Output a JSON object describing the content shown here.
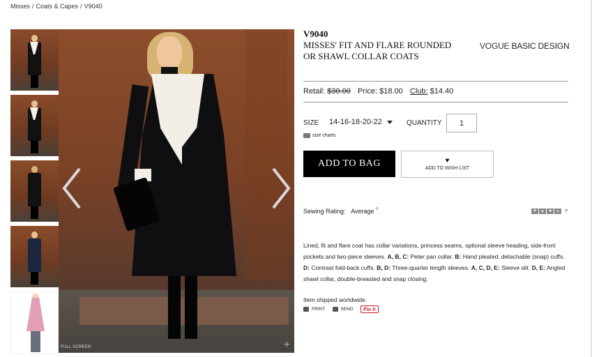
{
  "breadcrumb": [
    "Misses",
    "Coats & Capes",
    "V9040"
  ],
  "breadcrumb_sep": "/",
  "gallery": {
    "thumbnails": [
      "photo-front",
      "photo-side",
      "photo-back",
      "photo-navy",
      "sketch-pink"
    ],
    "prev_icon": "chevron-left-icon",
    "next_icon": "chevron-right-icon",
    "full_screen_label": "FULL SCREEN",
    "zoom_label": "+"
  },
  "product": {
    "sku": "V9040",
    "title": "MISSES' FIT AND FLARE ROUNDED OR SHAWL COLLAR COATS",
    "brand_part1": "VOGUE",
    "brand_part2": "BASIC DESIGN"
  },
  "pricing": {
    "retail_label": "Retail:",
    "retail_value": "$30.00",
    "price_label": "Price:",
    "price_value": "$18.00",
    "club_label": "Club:",
    "club_value": "$14.40"
  },
  "options": {
    "size_label": "SIZE",
    "size_selected": "14-16-18-20-22",
    "quantity_label": "QUANTITY",
    "quantity_value": "1",
    "size_charts_label": "size charts"
  },
  "buttons": {
    "add_to_bag": "ADD TO BAG",
    "add_to_wishlist": "ADD TO WISH LIST"
  },
  "rating": {
    "label": "Sewing Rating:",
    "value": "Average",
    "sup": "?",
    "help": "?"
  },
  "description": {
    "line1": "Lined, fit and flare coat has collar variations, princess seams, optional sleeve heading, side-front pockets and two-piece sleeves.",
    "v1": "A, B, C:",
    "t1": "Peter pan collar.",
    "v2": "B:",
    "t2": "Hand pleated, detachable (snap) cuffs.",
    "v3": "D:",
    "t3": "Contrast fold-back cuffs.",
    "v4": "B, D:",
    "t4": "Three-quarter length sleeves.",
    "v5": "A, C, D, E:",
    "t5": "Sleeve slit.",
    "v6": "D, E:",
    "t6": "Angled shawl collar, double-breasted and snap closing."
  },
  "shipping": "Item shipped worldwide.",
  "share": {
    "print": "PRINT",
    "send": "SEND",
    "pinit": "Pin it"
  },
  "colors": {
    "accent_button": "#000000",
    "pin_red": "#c8232c"
  }
}
